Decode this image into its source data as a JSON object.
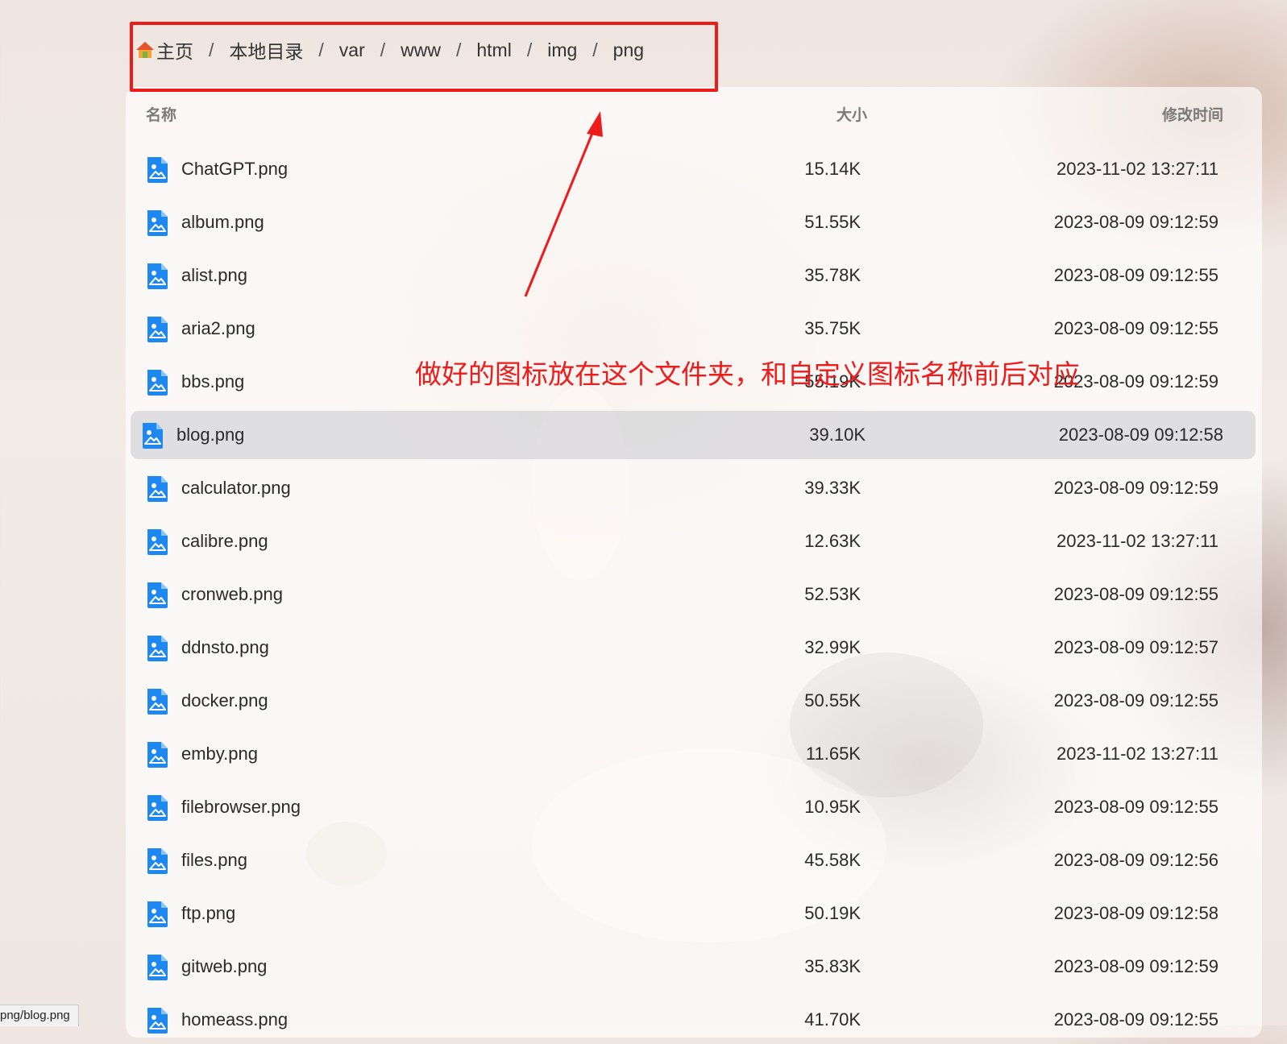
{
  "breadcrumb": {
    "home": "主页",
    "items": [
      "本地目录",
      "var",
      "www",
      "html",
      "img",
      "png"
    ],
    "separator": "/"
  },
  "table": {
    "headers": {
      "name": "名称",
      "size": "大小",
      "time": "修改时间"
    },
    "rows": [
      {
        "name": "ChatGPT.png",
        "size": "15.14K",
        "time": "2023-11-02 13:27:11"
      },
      {
        "name": "album.png",
        "size": "51.55K",
        "time": "2023-08-09 09:12:59"
      },
      {
        "name": "alist.png",
        "size": "35.78K",
        "time": "2023-08-09 09:12:55"
      },
      {
        "name": "aria2.png",
        "size": "35.75K",
        "time": "2023-08-09 09:12:55"
      },
      {
        "name": "bbs.png",
        "size": "55.19K",
        "time": "2023-08-09 09:12:59"
      },
      {
        "name": "blog.png",
        "size": "39.10K",
        "time": "2023-08-09 09:12:58",
        "hovered": true
      },
      {
        "name": "calculator.png",
        "size": "39.33K",
        "time": "2023-08-09 09:12:59"
      },
      {
        "name": "calibre.png",
        "size": "12.63K",
        "time": "2023-11-02 13:27:11"
      },
      {
        "name": "cronweb.png",
        "size": "52.53K",
        "time": "2023-08-09 09:12:55"
      },
      {
        "name": "ddnsto.png",
        "size": "32.99K",
        "time": "2023-08-09 09:12:57"
      },
      {
        "name": "docker.png",
        "size": "50.55K",
        "time": "2023-08-09 09:12:55"
      },
      {
        "name": "emby.png",
        "size": "11.65K",
        "time": "2023-11-02 13:27:11"
      },
      {
        "name": "filebrowser.png",
        "size": "10.95K",
        "time": "2023-08-09 09:12:55"
      },
      {
        "name": "files.png",
        "size": "45.58K",
        "time": "2023-08-09 09:12:56"
      },
      {
        "name": "ftp.png",
        "size": "50.19K",
        "time": "2023-08-09 09:12:58"
      },
      {
        "name": "gitweb.png",
        "size": "35.83K",
        "time": "2023-08-09 09:12:59"
      },
      {
        "name": "homeass.png",
        "size": "41.70K",
        "time": "2023-08-09 09:12:55"
      }
    ]
  },
  "annotation": {
    "text": "做好的图标放在这个文件夹，和自定义图标名称前后对应",
    "color": "#ee1b1b"
  },
  "status_bar": {
    "text": "png/blog.png"
  },
  "colors": {
    "file_icon": "#1e88f2",
    "hover_row": "#c8c8cd"
  },
  "icons": {
    "home": "home-icon",
    "file": "image-file-icon"
  }
}
